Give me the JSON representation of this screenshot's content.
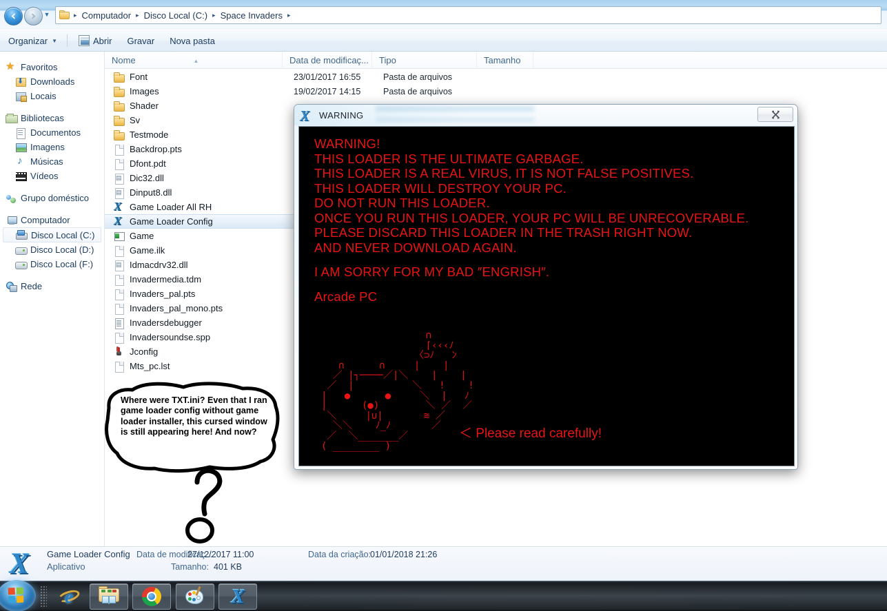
{
  "window": {
    "address": {
      "crumbs": [
        "Computador",
        "Disco Local (C:)",
        "Space Invaders"
      ],
      "separator": "▸"
    },
    "toolbar": {
      "organizar": "Organizar",
      "abrir": "Abrir",
      "gravar": "Gravar",
      "nova_pasta": "Nova pasta"
    }
  },
  "sidebar": {
    "groups": [
      {
        "header": {
          "label": "Favoritos",
          "icon": "star-icon"
        },
        "items": [
          {
            "label": "Downloads",
            "icon": "downloads-icon"
          },
          {
            "label": "Locais",
            "icon": "places-icon"
          }
        ]
      },
      {
        "header": {
          "label": "Bibliotecas",
          "icon": "libraries-icon"
        },
        "items": [
          {
            "label": "Documentos",
            "icon": "documents-icon"
          },
          {
            "label": "Imagens",
            "icon": "pictures-icon"
          },
          {
            "label": "Músicas",
            "icon": "music-icon"
          },
          {
            "label": "Vídeos",
            "icon": "videos-icon"
          }
        ]
      },
      {
        "header": {
          "label": "Grupo doméstico",
          "icon": "homegroup-icon"
        },
        "items": []
      },
      {
        "header": {
          "label": "Computador",
          "icon": "computer-icon"
        },
        "items": [
          {
            "label": "Disco Local (C:)",
            "icon": "system-drive-icon",
            "selected": true
          },
          {
            "label": "Disco Local (D:)",
            "icon": "drive-icon"
          },
          {
            "label": "Disco Local (F:)",
            "icon": "drive-icon"
          }
        ]
      },
      {
        "header": {
          "label": "Rede",
          "icon": "network-icon"
        },
        "items": []
      }
    ]
  },
  "filelist": {
    "columns": [
      {
        "label": "Nome",
        "sorted": true
      },
      {
        "label": "Data de modificaç...",
        "sorted": false
      },
      {
        "label": "Tipo",
        "sorted": false
      },
      {
        "label": "Tamanho",
        "sorted": false
      }
    ],
    "rows": [
      {
        "name": "Font",
        "date": "23/01/2017 16:55",
        "type": "Pasta de arquivos",
        "size": "",
        "icon": "folder-icon"
      },
      {
        "name": "Images",
        "date": "19/02/2017 14:15",
        "type": "Pasta de arquivos",
        "size": "",
        "icon": "folder-icon"
      },
      {
        "name": "Shader",
        "date": "",
        "type": "",
        "size": "",
        "icon": "folder-icon"
      },
      {
        "name": "Sv",
        "date": "",
        "type": "",
        "size": "",
        "icon": "folder-icon"
      },
      {
        "name": "Testmode",
        "date": "",
        "type": "",
        "size": "",
        "icon": "folder-icon"
      },
      {
        "name": "Backdrop.pts",
        "date": "",
        "type": "",
        "size": "",
        "icon": "file-icon"
      },
      {
        "name": "Dfont.pdt",
        "date": "",
        "type": "",
        "size": "",
        "icon": "file-icon"
      },
      {
        "name": "Dic32.dll",
        "date": "",
        "type": "",
        "size": "",
        "icon": "dll-icon"
      },
      {
        "name": "Dinput8.dll",
        "date": "",
        "type": "",
        "size": "",
        "icon": "dll-icon"
      },
      {
        "name": "Game Loader All RH",
        "date": "",
        "type": "",
        "size": "",
        "icon": "x-app-icon"
      },
      {
        "name": "Game Loader Config",
        "date": "",
        "type": "",
        "size": "",
        "icon": "x-app-icon",
        "selected": true
      },
      {
        "name": "Game",
        "date": "",
        "type": "",
        "size": "",
        "icon": "game-app-icon"
      },
      {
        "name": "Game.ilk",
        "date": "",
        "type": "",
        "size": "",
        "icon": "file-icon"
      },
      {
        "name": "Idmacdrv32.dll",
        "date": "",
        "type": "",
        "size": "",
        "icon": "dll-icon"
      },
      {
        "name": "Invadermedia.tdm",
        "date": "",
        "type": "",
        "size": "",
        "icon": "file-icon"
      },
      {
        "name": "Invaders_pal.pts",
        "date": "",
        "type": "",
        "size": "",
        "icon": "file-icon"
      },
      {
        "name": "Invaders_pal_mono.pts",
        "date": "",
        "type": "",
        "size": "",
        "icon": "file-icon"
      },
      {
        "name": "Invadersdebugger",
        "date": "",
        "type": "",
        "size": "",
        "icon": "text-file-icon"
      },
      {
        "name": "Invadersoundse.spp",
        "date": "",
        "type": "",
        "size": "",
        "icon": "file-icon"
      },
      {
        "name": "Jconfig",
        "date": "",
        "type": "",
        "size": "",
        "icon": "joystick-icon"
      },
      {
        "name": "Mts_pc.lst",
        "date": "",
        "type": "",
        "size": "",
        "icon": "file-icon"
      }
    ]
  },
  "statusbar": {
    "name": "Game Loader Config",
    "kind": "Aplicativo",
    "modified_label": "Data de modificaç...",
    "modified_value": "27/12/2017 11:00",
    "size_label": "Tamanho:",
    "size_value": "401 KB",
    "created_label": "Data da criação:",
    "created_value": "01/01/2018 21:26"
  },
  "warning_dialog": {
    "title": "WARNING",
    "close_glyph": "✖",
    "text_color": "#e81414",
    "background_color": "#000000",
    "lines": [
      "WARNING!",
      "THIS LOADER IS THE ULTIMATE GARBAGE.",
      "THIS LOADER IS A REAL VIRUS, IT IS NOT FALSE POSITIVES.",
      "THIS LOADER WILL DESTROY YOUR PC.",
      "DO NOT RUN THIS LOADER.",
      "ONCE YOU RUN THIS LOADER, YOUR PC WILL BE UNRECOVERABLE.",
      "PLEASE DISCARD THIS LOADER IN THE TRASH RIGHT NOW.",
      "AND NEVER DOWNLOAD AGAIN.",
      "",
      "I AM SORRY FOR MY BAD ″ENGRISH″.",
      "",
      "Arcade PC"
    ],
    "ascii_art": "                  ∩\n                  ⌈‹‹‹ﾉ\n                〈⊃ﾉ   ﾝ\n   ∩      ∩     |    |\n  ／ |┐────／|＼    |    |\n ／  |          ＼   !    !\n|   ●      ●     ＼  |   ﾉ\n|      (●)        ＼ ／  ／\n ＼     |∪|       ≋ ／\n  ＼＼    ﾉ_ﾉ       ／\n ／  ＼_______／\n( ________ )",
    "read_carefully": "＜ Please read carefully!"
  },
  "annotation": {
    "bubble_text": "Where were TXT.ini? Even that I ran game loader config without game loader installer, this cursed window is still appearing here! And now?",
    "question_mark": "?",
    "ink_color": "#000000"
  },
  "taskbar": {
    "start_label": "Start",
    "buttons": [
      {
        "name": "internet-explorer",
        "label": "Internet Explorer"
      },
      {
        "name": "windows-explorer",
        "label": "Windows Explorer"
      },
      {
        "name": "google-chrome",
        "label": "Google Chrome"
      },
      {
        "name": "paint",
        "label": "Paint"
      },
      {
        "name": "game-loader",
        "label": "Game Loader Config"
      }
    ]
  }
}
